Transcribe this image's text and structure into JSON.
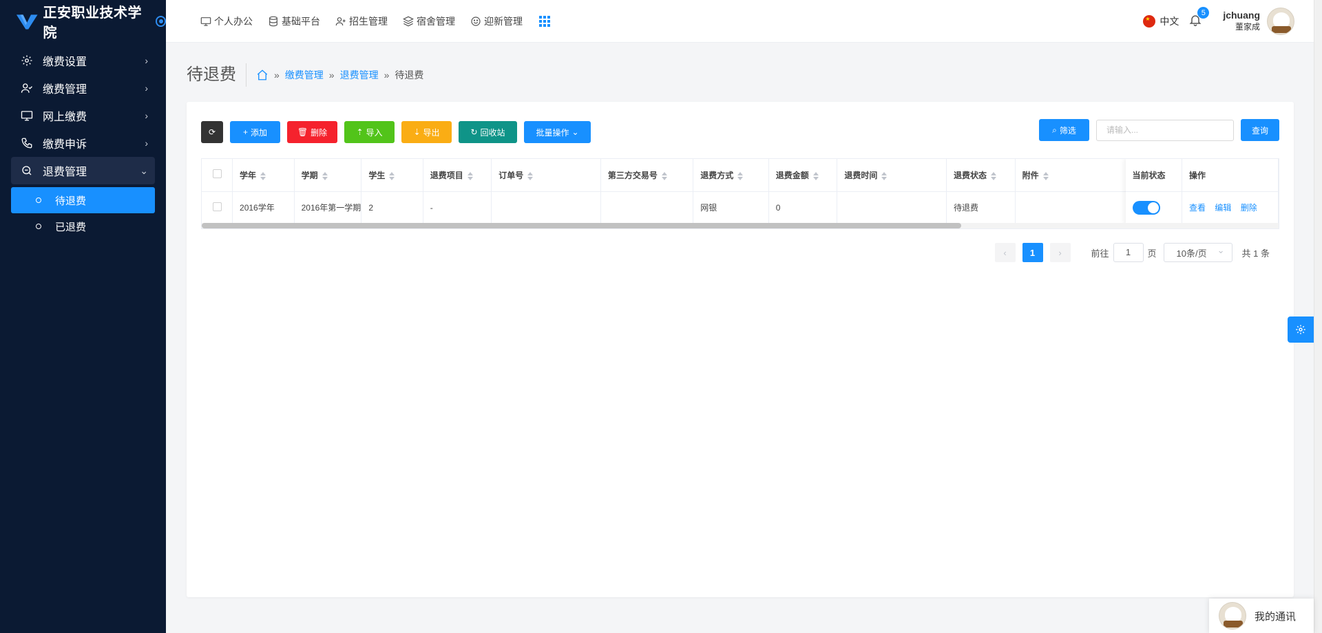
{
  "app": {
    "title": "正安职业技术学院"
  },
  "sidebar": {
    "items": [
      {
        "label": "缴费设置",
        "icon": "gear-icon"
      },
      {
        "label": "缴费管理",
        "icon": "user-check-icon"
      },
      {
        "label": "网上缴费",
        "icon": "monitor-icon"
      },
      {
        "label": "缴费申诉",
        "icon": "phone-icon"
      },
      {
        "label": "退费管理",
        "icon": "search-icon"
      }
    ],
    "subitems": [
      {
        "label": "待退费",
        "active": true
      },
      {
        "label": "已退费",
        "active": false
      }
    ]
  },
  "topnav": {
    "items": [
      {
        "label": "个人办公",
        "icon": "monitor-icon"
      },
      {
        "label": "基础平台",
        "icon": "database-icon"
      },
      {
        "label": "招生管理",
        "icon": "user-plus-icon"
      },
      {
        "label": "宿舍管理",
        "icon": "layers-icon"
      },
      {
        "label": "迎新管理",
        "icon": "smile-icon"
      }
    ],
    "language": "中文",
    "notification_count": "5",
    "username": "jchuang",
    "realname": "董家成"
  },
  "page": {
    "title": "待退费",
    "breadcrumb": [
      "缴费管理",
      "退费管理",
      "待退费"
    ]
  },
  "toolbar": {
    "add": "添加",
    "delete": "删除",
    "import": "导入",
    "export": "导出",
    "recycle": "回收站",
    "batch": "批量操作",
    "filter": "筛选",
    "search_placeholder": "请输入...",
    "query": "查询"
  },
  "table": {
    "columns": [
      "学年",
      "学期",
      "学生",
      "退费项目",
      "订单号",
      "第三方交易号",
      "退费方式",
      "退费金额",
      "退费时间",
      "退费状态",
      "附件"
    ],
    "fixed_columns": [
      "当前状态",
      "操作"
    ],
    "rows": [
      {
        "cells": [
          "2016学年",
          "2016年第一学期",
          "2",
          "-",
          "",
          "",
          "网银",
          "0",
          "",
          "待退费",
          ""
        ],
        "status_on": true,
        "actions": [
          "查看",
          "编辑",
          "删除"
        ]
      }
    ]
  },
  "pagination": {
    "current": "1",
    "goto_label": "前往",
    "goto_value": "1",
    "page_unit": "页",
    "page_size": "10条/页",
    "total": "共 1 条"
  },
  "chat": {
    "label": "我的通讯"
  },
  "colors": {
    "primary": "#1890ff",
    "sidebar_bg": "#0b1a33",
    "danger": "#f5222d",
    "success": "#52c41a",
    "warning": "#faad14",
    "teal": "#0f9488"
  }
}
